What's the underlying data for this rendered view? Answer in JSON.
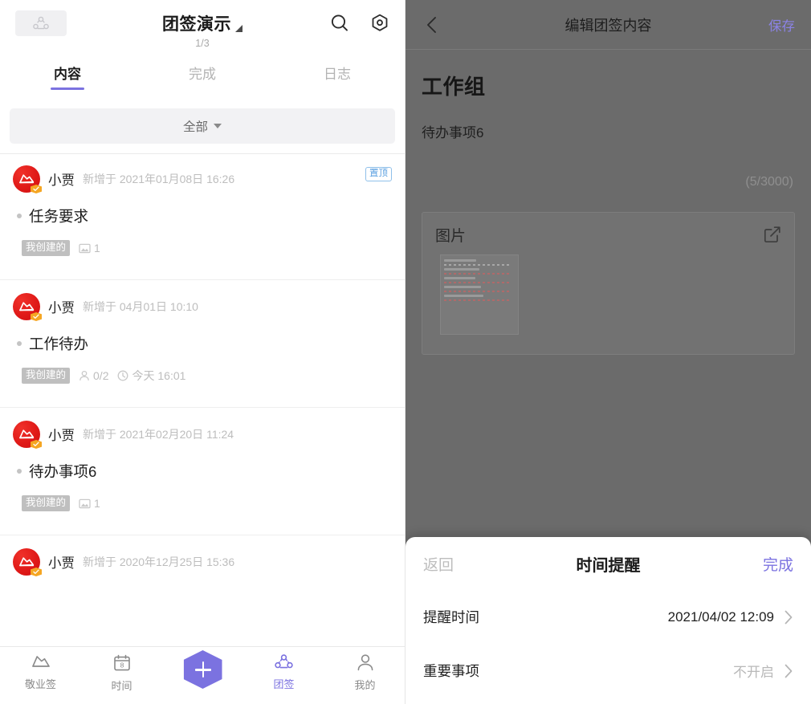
{
  "left": {
    "header": {
      "group_icon": "group-dots-icon",
      "title": "团签演示",
      "title_caret": "caret-down-icon",
      "page_indicator": "1/3",
      "search_icon": "search-icon",
      "settings_icon": "hexagon-settings-icon"
    },
    "tabs": [
      {
        "label": "内容",
        "active": true
      },
      {
        "label": "完成",
        "active": false
      },
      {
        "label": "日志",
        "active": false
      }
    ],
    "filter": {
      "label": "全部",
      "caret": "caret-down-icon"
    },
    "notes": [
      {
        "author": "小贾",
        "meta": "新增于 2021年01月08日 16:26",
        "pin_badge": "置顶",
        "title": "任务要求",
        "tag": "我创建的",
        "chips": [
          {
            "icon": "image-icon",
            "text": "1"
          }
        ]
      },
      {
        "author": "小贾",
        "meta": "新增于 04月01日 10:10",
        "pin_badge": "",
        "title": "工作待办",
        "tag": "我创建的",
        "chips": [
          {
            "icon": "person-icon",
            "text": "0/2"
          },
          {
            "icon": "clock-icon",
            "text": "今天 16:01"
          }
        ]
      },
      {
        "author": "小贾",
        "meta": "新增于 2021年02月20日 11:24",
        "pin_badge": "",
        "title": "待办事项6",
        "tag": "我创建的",
        "chips": [
          {
            "icon": "image-icon",
            "text": "1"
          }
        ]
      },
      {
        "author": "小贾",
        "meta": "新增于 2020年12月25日 15:36",
        "pin_badge": "",
        "title": "",
        "tag": "",
        "chips": []
      }
    ],
    "bottom_nav": [
      {
        "label": "敬业签",
        "icon": "note-flag-icon",
        "active": false
      },
      {
        "label": "时间",
        "icon": "calendar-icon",
        "active": false
      },
      {
        "label": "团签",
        "icon": "group-dots-icon",
        "active": true
      },
      {
        "label": "我的",
        "icon": "person-icon",
        "active": false
      }
    ],
    "fab": {
      "icon": "plus-icon"
    },
    "calendar_day": "8"
  },
  "right": {
    "header": {
      "back_icon": "chevron-left-icon",
      "title": "编辑团签内容",
      "save_label": "保存"
    },
    "content": {
      "heading": "工作组",
      "body": "待办事项6",
      "char_count": "(5/3000)"
    },
    "image_card": {
      "title": "图片",
      "edit_icon": "edit-square-icon"
    },
    "sheet": {
      "back_label": "返回",
      "title": "时间提醒",
      "done_label": "完成",
      "rows": [
        {
          "label": "提醒时间",
          "value": "2021/04/02 12:09",
          "muted": false,
          "chevron": "chevron-right-icon"
        },
        {
          "label": "重要事项",
          "value": "不开启",
          "muted": true,
          "chevron": "chevron-right-icon"
        }
      ]
    }
  },
  "colors": {
    "accent": "#7b72e0",
    "avatar_red": "#e01a18",
    "pin_blue": "#5a9fe0",
    "overlay_gray": "#6b6b6b"
  }
}
